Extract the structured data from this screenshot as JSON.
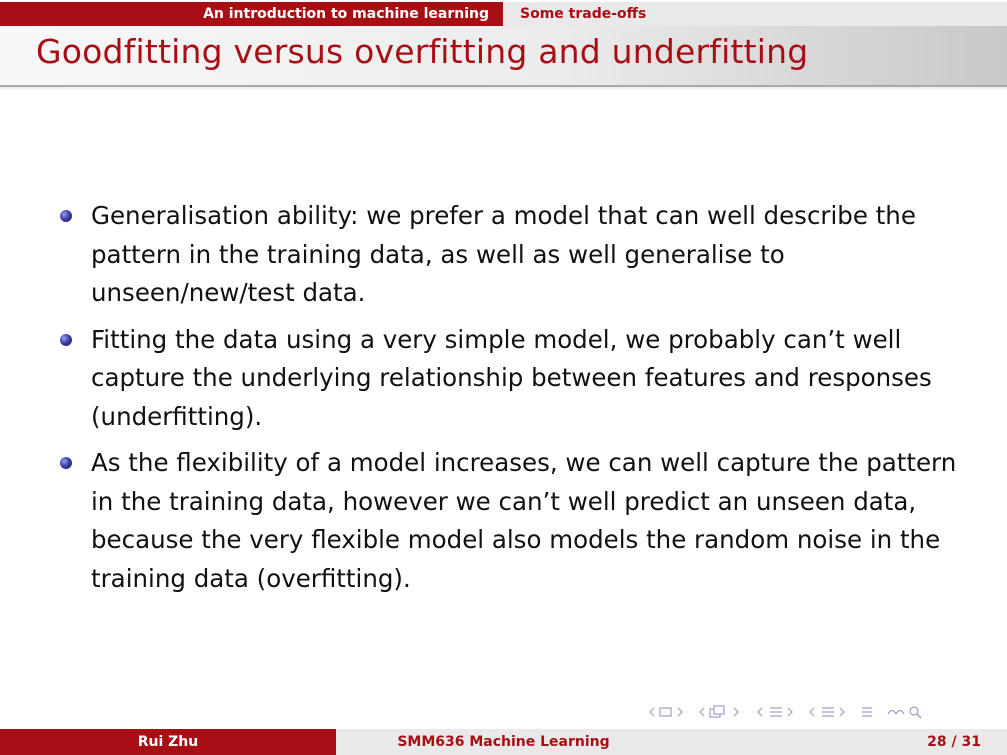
{
  "header": {
    "section": "An introduction to machine learning",
    "subsection": "Some trade-offs"
  },
  "slide": {
    "title": "Goodfitting versus overfitting and underfitting",
    "bullets": [
      "Generalisation ability: we prefer a model that can well describe the pattern in the training data, as well as well generalise to unseen/new/test data.",
      "Fitting the data using a very simple model, we probably can’t well capture the underlying relationship between features and responses (underfitting).",
      "As the flexibility of a model increases, we can well capture the pattern in the training data, however we can’t well predict an unseen data, because the very flexible model also models the random noise in the training data (overfitting)."
    ]
  },
  "footer": {
    "author": "Rui Zhu",
    "course": "SMM636 Machine Learning",
    "page": "28 / 31"
  },
  "nav_icons": [
    "frame-nav-icon",
    "subsection-nav-icon",
    "section-nav-icon",
    "doc-nav-icon",
    "align-icon",
    "search-icon"
  ],
  "colors": {
    "accent": "#a80f14",
    "bar_grey": "#e9e9e9",
    "bullet": "#3a3fa8"
  }
}
